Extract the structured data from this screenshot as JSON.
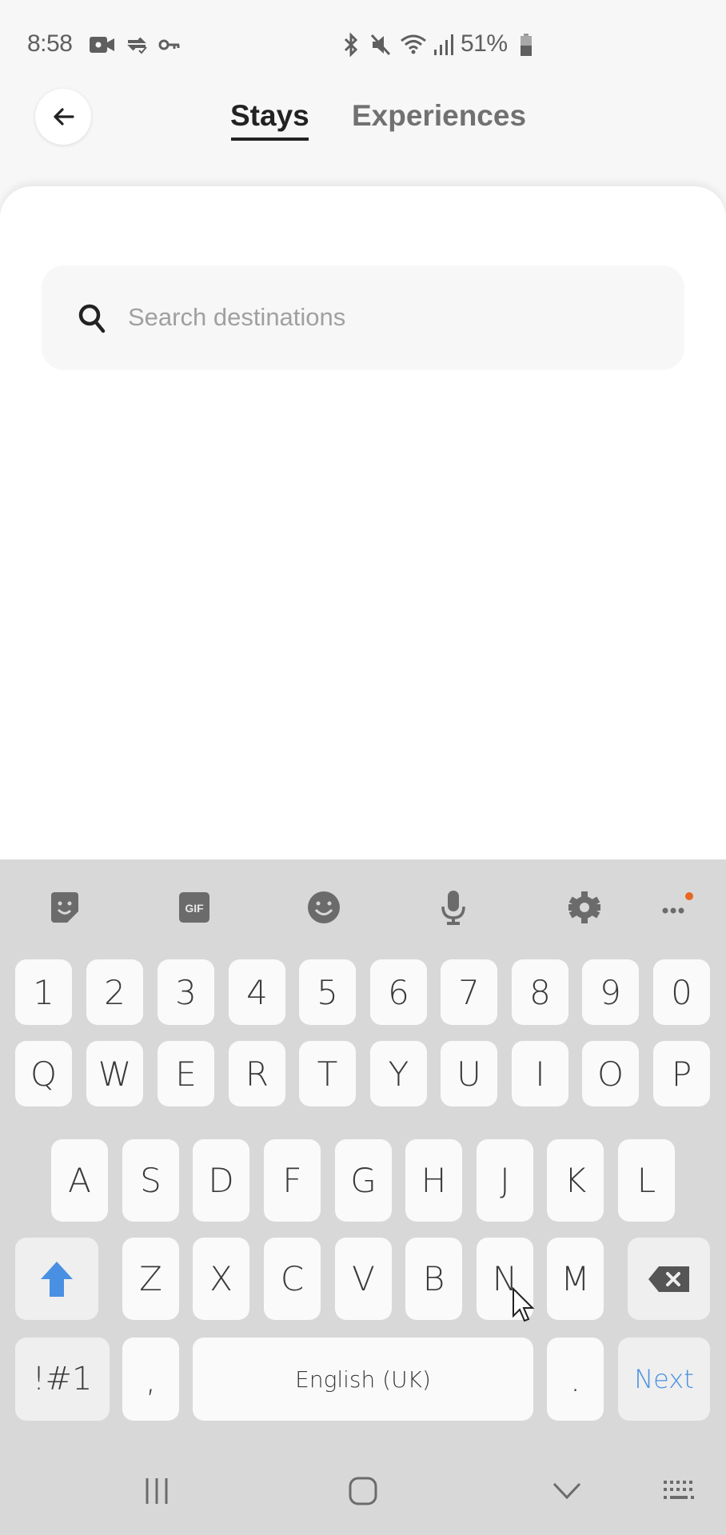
{
  "status_bar": {
    "time": "8:58",
    "left_icons": [
      "video-camera-icon",
      "sync-check-icon",
      "vpn-key-icon"
    ],
    "right_icons": [
      "bluetooth-icon",
      "mute-icon",
      "wifi-icon",
      "signal-icon"
    ],
    "battery_percent": "51%"
  },
  "header": {
    "back_label": "Back",
    "tabs": [
      {
        "label": "Stays",
        "active": true
      },
      {
        "label": "Experiences",
        "active": false
      }
    ]
  },
  "search": {
    "placeholder": "Search destinations",
    "value": ""
  },
  "keyboard": {
    "toolbar": [
      "sticker-icon",
      "gif-icon",
      "emoji-icon",
      "microphone-icon",
      "settings-icon",
      "more-icon"
    ],
    "gif_label": "GIF",
    "accent_dot_color": "#e8681f",
    "rows": {
      "numbers": [
        "1",
        "2",
        "3",
        "4",
        "5",
        "6",
        "7",
        "8",
        "9",
        "0"
      ],
      "qwerty": [
        "Q",
        "W",
        "E",
        "R",
        "T",
        "Y",
        "U",
        "I",
        "O",
        "P"
      ],
      "asdf": [
        "A",
        "S",
        "D",
        "F",
        "G",
        "H",
        "J",
        "K",
        "L"
      ],
      "zxcv": [
        "Z",
        "X",
        "C",
        "V",
        "B",
        "N",
        "M"
      ]
    },
    "symbols_label": "!#1",
    "comma_label": ",",
    "space_label": "English (UK)",
    "period_label": ".",
    "action_label": "Next",
    "shift_color": "#4a90e2"
  },
  "nav_bar": {
    "icons": [
      "recent-apps-icon",
      "home-icon",
      "hide-keyboard-icon",
      "keyboard-switch-icon"
    ]
  }
}
